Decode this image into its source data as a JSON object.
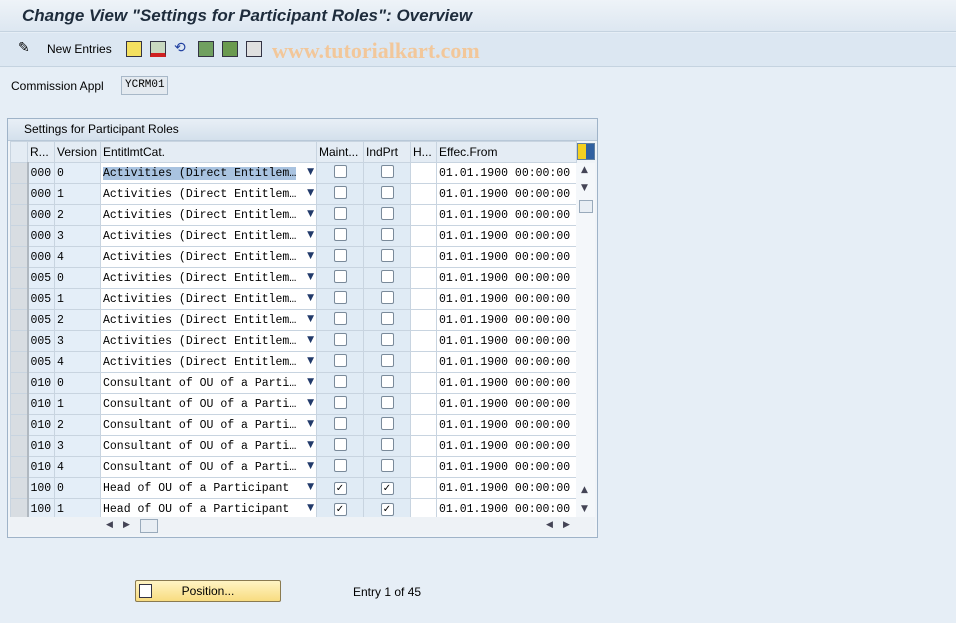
{
  "title": "Change View \"Settings for Participant Roles\": Overview",
  "toolbar": {
    "new_entries": "New Entries",
    "icons": [
      "edit-pencil-icon",
      "copy-icon",
      "delete-icon",
      "undo-icon",
      "select-all-icon",
      "select-block-icon",
      "deselect-all-icon"
    ]
  },
  "watermark": "www.tutorialkart.com",
  "filter": {
    "label": "Commission Appl",
    "value": "YCRM01"
  },
  "table": {
    "title": "Settings for Participant Roles",
    "columns": [
      "R...",
      "Version",
      "EntitlmtCat.",
      "Maint...",
      "IndPrt",
      "H...",
      "Effec.From"
    ],
    "rows": [
      [
        "000",
        "0",
        "Activities (Direct Entitlem…",
        false,
        false,
        "01.01.1900 00:00:00"
      ],
      [
        "000",
        "1",
        "Activities (Direct Entitlem…",
        false,
        false,
        "01.01.1900 00:00:00"
      ],
      [
        "000",
        "2",
        "Activities (Direct Entitlem…",
        false,
        false,
        "01.01.1900 00:00:00"
      ],
      [
        "000",
        "3",
        "Activities (Direct Entitlem…",
        false,
        false,
        "01.01.1900 00:00:00"
      ],
      [
        "000",
        "4",
        "Activities (Direct Entitlem…",
        false,
        false,
        "01.01.1900 00:00:00"
      ],
      [
        "005",
        "0",
        "Activities (Direct Entitlem…",
        false,
        false,
        "01.01.1900 00:00:00"
      ],
      [
        "005",
        "1",
        "Activities (Direct Entitlem…",
        false,
        false,
        "01.01.1900 00:00:00"
      ],
      [
        "005",
        "2",
        "Activities (Direct Entitlem…",
        false,
        false,
        "01.01.1900 00:00:00"
      ],
      [
        "005",
        "3",
        "Activities (Direct Entitlem…",
        false,
        false,
        "01.01.1900 00:00:00"
      ],
      [
        "005",
        "4",
        "Activities (Direct Entitlem…",
        false,
        false,
        "01.01.1900 00:00:00"
      ],
      [
        "010",
        "0",
        "Consultant of OU of a Parti…",
        false,
        false,
        "01.01.1900 00:00:00"
      ],
      [
        "010",
        "1",
        "Consultant of OU of a Parti…",
        false,
        false,
        "01.01.1900 00:00:00"
      ],
      [
        "010",
        "2",
        "Consultant of OU of a Parti…",
        false,
        false,
        "01.01.1900 00:00:00"
      ],
      [
        "010",
        "3",
        "Consultant of OU of a Parti…",
        false,
        false,
        "01.01.1900 00:00:00"
      ],
      [
        "010",
        "4",
        "Consultant of OU of a Parti…",
        false,
        false,
        "01.01.1900 00:00:00"
      ],
      [
        "100",
        "0",
        "Head of OU of a Participant",
        true,
        true,
        "01.01.1900 00:00:00"
      ],
      [
        "100",
        "1",
        "Head of OU of a Participant",
        true,
        true,
        "01.01.1900 00:00:00"
      ]
    ]
  },
  "footer": {
    "position_button": "Position...",
    "entry_text": "Entry 1 of 45"
  }
}
